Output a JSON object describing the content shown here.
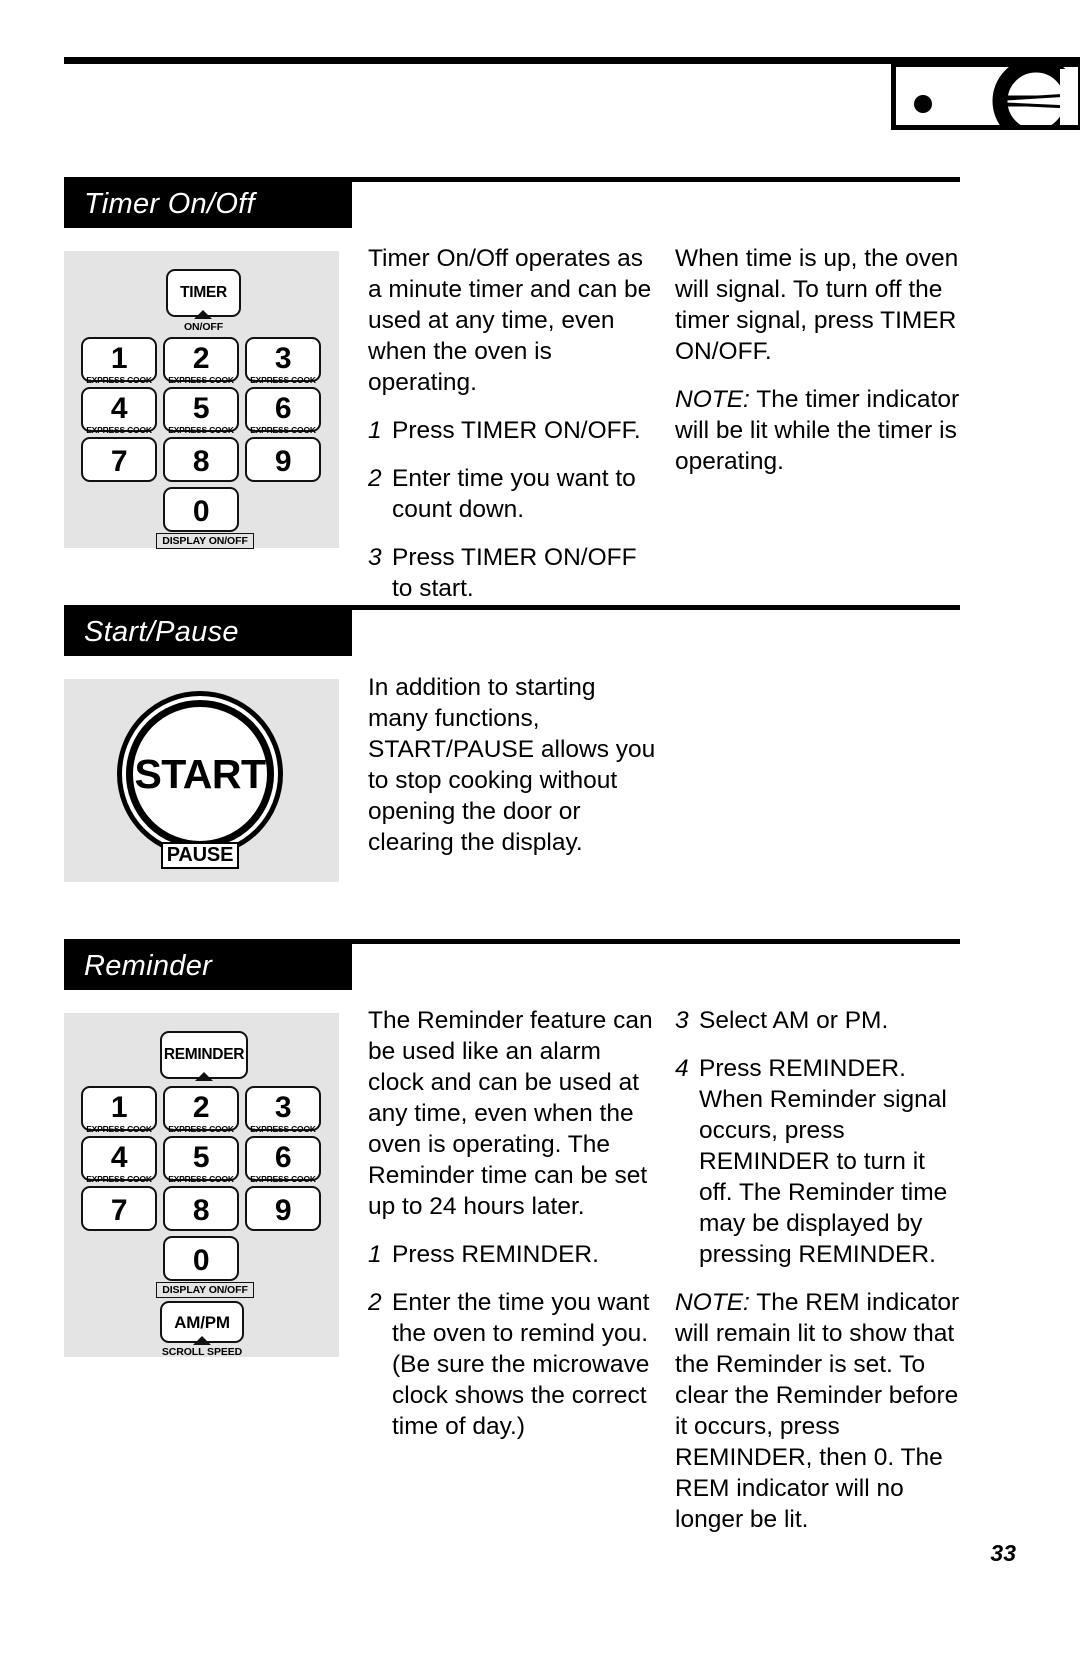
{
  "page": {
    "number": "33",
    "brand_logo": "ge-monogram-logo"
  },
  "sections": [
    {
      "id": "timer-on-off",
      "title": "Timer On/Off",
      "keypad": {
        "top_key": {
          "label": "TIMER",
          "sublabel": "ON/OFF"
        },
        "keys": [
          {
            "num": "1",
            "sub": "EXPRESS COOK"
          },
          {
            "num": "2",
            "sub": "EXPRESS COOK"
          },
          {
            "num": "3",
            "sub": "EXPRESS COOK"
          },
          {
            "num": "4",
            "sub": "EXPRESS COOK"
          },
          {
            "num": "5",
            "sub": "EXPRESS COOK"
          },
          {
            "num": "6",
            "sub": "EXPRESS COOK"
          },
          {
            "num": "7",
            "sub": ""
          },
          {
            "num": "8",
            "sub": ""
          },
          {
            "num": "9",
            "sub": ""
          }
        ],
        "zero_key": {
          "num": "0",
          "label": "DISPLAY ON/OFF"
        }
      },
      "left_column": {
        "intro": "Timer On/Off operates as a minute timer and can be used at any time, even when the oven is operating.",
        "steps": [
          {
            "n": "1",
            "text": "Press TIMER ON/OFF."
          },
          {
            "n": "2",
            "text": "Enter time you want to count down."
          },
          {
            "n": "3",
            "text": "Press TIMER ON/OFF to start."
          }
        ]
      },
      "right_column": {
        "intro": "When time is up, the oven will signal. To turn off the timer signal, press TIMER ON/OFF.",
        "note_label": "NOTE:",
        "note": " The timer indicator will be lit while the timer is operating."
      }
    },
    {
      "id": "start-pause",
      "title": "Start/Pause",
      "artwork": {
        "start_label": "START",
        "pause_label": "PAUSE"
      },
      "left_column": {
        "intro": "In addition to starting many functions, START/PAUSE allows you to stop cooking without opening the door or clearing the display."
      }
    },
    {
      "id": "reminder",
      "title": "Reminder",
      "keypad": {
        "top_key": {
          "label": "REMINDER",
          "sublabel": ""
        },
        "keys": [
          {
            "num": "1",
            "sub": "EXPRESS COOK"
          },
          {
            "num": "2",
            "sub": "EXPRESS COOK"
          },
          {
            "num": "3",
            "sub": "EXPRESS COOK"
          },
          {
            "num": "4",
            "sub": "EXPRESS COOK"
          },
          {
            "num": "5",
            "sub": "EXPRESS COOK"
          },
          {
            "num": "6",
            "sub": "EXPRESS COOK"
          },
          {
            "num": "7",
            "sub": ""
          },
          {
            "num": "8",
            "sub": ""
          },
          {
            "num": "9",
            "sub": ""
          }
        ],
        "zero_key": {
          "num": "0",
          "label": "DISPLAY ON/OFF"
        },
        "ampm_key": {
          "label": "AM/PM",
          "sublabel": "SCROLL SPEED"
        }
      },
      "left_column": {
        "intro": "The Reminder feature can be used like an alarm clock and can be used at any time, even when the oven is operating. The Reminder time can be set up to 24 hours later.",
        "steps": [
          {
            "n": "1",
            "text": "Press REMINDER."
          },
          {
            "n": "2",
            "text": "Enter the time you want the oven to remind you. (Be sure the microwave clock shows the correct time of day.)"
          }
        ]
      },
      "right_column": {
        "steps": [
          {
            "n": "3",
            "text": "Select AM or PM."
          },
          {
            "n": "4",
            "text": "Press REMINDER. When Reminder signal occurs, press REMINDER to turn it off. The Reminder time may be displayed by pressing REMINDER."
          }
        ],
        "note_label": "NOTE:",
        "note": " The REM indicator will remain lit to show that the Reminder is set. To clear the Reminder before it occurs, press REMINDER, then 0. The REM indicator will no longer be lit."
      }
    }
  ]
}
